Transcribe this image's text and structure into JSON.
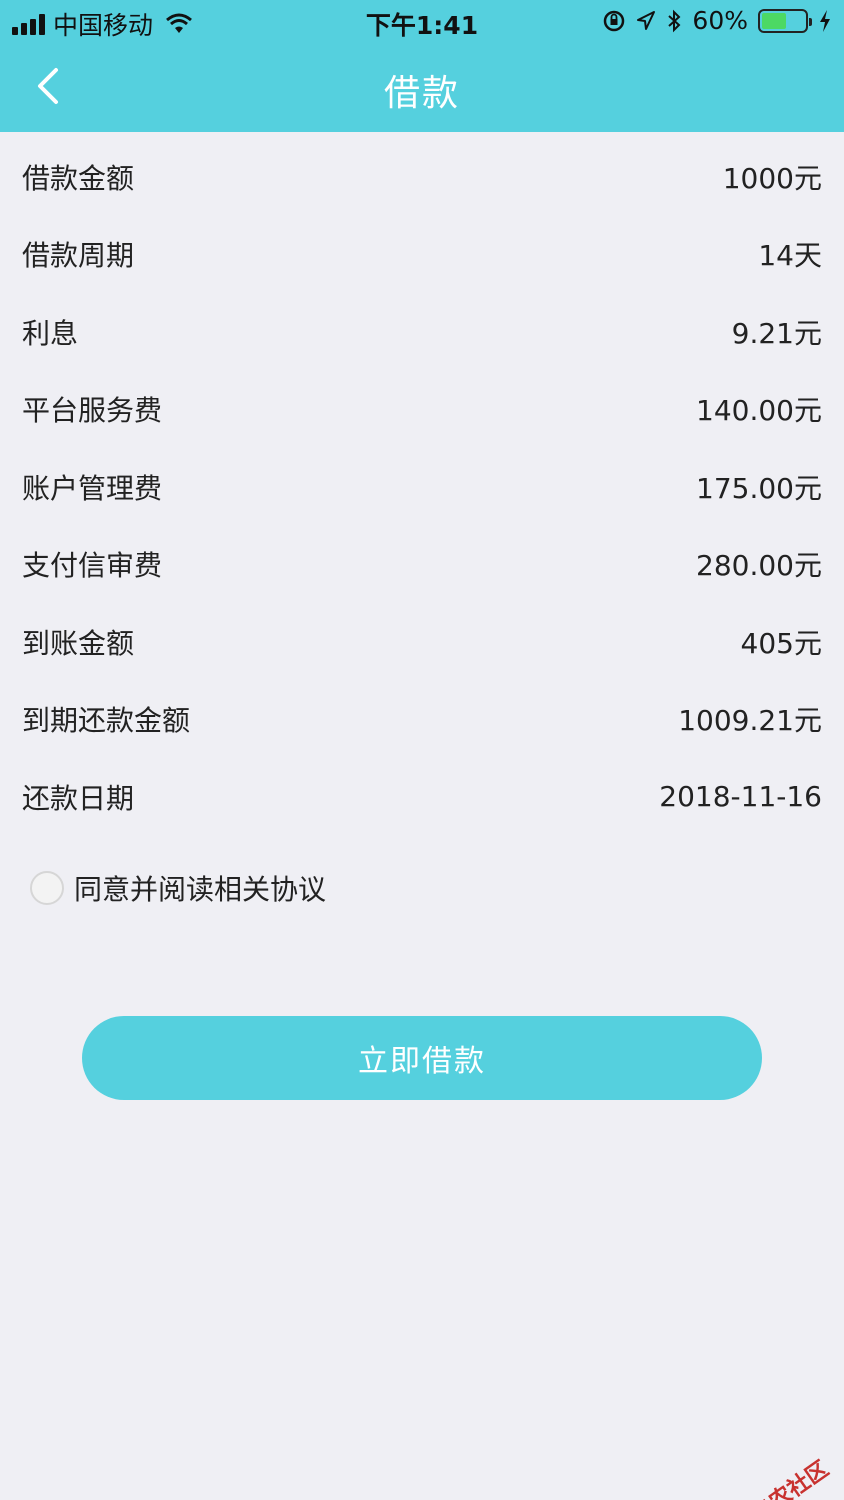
{
  "status_bar": {
    "carrier": "中国移动",
    "time": "下午1:41",
    "battery": "60%"
  },
  "header": {
    "title": "借款"
  },
  "rows": [
    {
      "label": "借款金额",
      "value": "1000元"
    },
    {
      "label": "借款周期",
      "value": "14天"
    },
    {
      "label": "利息",
      "value": "9.21元"
    },
    {
      "label": "平台服务费",
      "value": "140.00元"
    },
    {
      "label": "账户管理费",
      "value": "175.00元"
    },
    {
      "label": "支付信审费",
      "value": "280.00元"
    },
    {
      "label": "到账金额",
      "value": "405元"
    },
    {
      "label": "到期还款金额",
      "value": "1009.21元"
    },
    {
      "label": "还款日期",
      "value": "2018-11-16"
    }
  ],
  "agreement": {
    "label": "同意并阅读相关协议",
    "checked": false
  },
  "submit_label": "立即借款",
  "watermark": "卡农社区",
  "colors": {
    "accent": "#55d0de",
    "background": "#efeff4",
    "battery": "#4cd964",
    "watermark": "#c8322f"
  },
  "icons": [
    "signal-icon",
    "wifi-icon",
    "orientation-lock-icon",
    "location-icon",
    "bluetooth-icon",
    "battery-icon",
    "charging-icon",
    "back-chevron-icon",
    "radio-icon",
    "watermark-logo-icon"
  ]
}
